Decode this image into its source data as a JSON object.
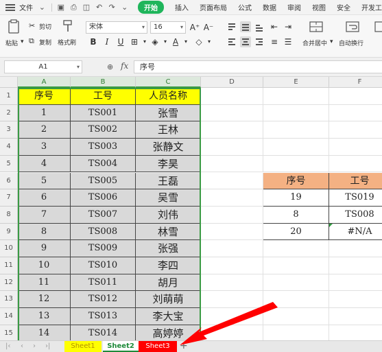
{
  "menubar": {
    "file_label": "文件",
    "tabs": [
      "开始",
      "插入",
      "页面布局",
      "公式",
      "数据",
      "审阅",
      "视图",
      "安全",
      "开发工"
    ]
  },
  "ribbon": {
    "cut_label": "剪切",
    "paste_label": "粘贴",
    "copy_label": "复制",
    "format_painter_label": "格式刷",
    "font_name": "宋体",
    "font_size": "16",
    "merge_label": "合并居中",
    "wrap_label": "自动换行"
  },
  "formula_bar": {
    "cell_ref": "A1",
    "fx": "fx",
    "content": "序号"
  },
  "columns": [
    "A",
    "B",
    "C",
    "D",
    "E",
    "F"
  ],
  "rows": [
    "1",
    "2",
    "3",
    "4",
    "5",
    "6",
    "7",
    "8",
    "9",
    "10",
    "11",
    "12",
    "13",
    "14",
    "15"
  ],
  "table_headers": [
    "序号",
    "工号",
    "人员名称"
  ],
  "table_rows": [
    [
      "1",
      "TS001",
      "张雪"
    ],
    [
      "2",
      "TS002",
      "王林"
    ],
    [
      "3",
      "TS003",
      "张静文"
    ],
    [
      "4",
      "TS004",
      "李昊"
    ],
    [
      "5",
      "TS005",
      "王磊"
    ],
    [
      "6",
      "TS006",
      "吴雪"
    ],
    [
      "7",
      "TS007",
      "刘伟"
    ],
    [
      "8",
      "TS008",
      "林雪"
    ],
    [
      "9",
      "TS009",
      "张强"
    ],
    [
      "10",
      "TS010",
      "李四"
    ],
    [
      "11",
      "TS011",
      "胡月"
    ],
    [
      "12",
      "TS012",
      "刘萌萌"
    ],
    [
      "13",
      "TS013",
      "李大宝"
    ],
    [
      "14",
      "TS014",
      "高婷婷"
    ]
  ],
  "lookup_headers": [
    "序号",
    "工号"
  ],
  "lookup_rows": [
    [
      "19",
      "TS019"
    ],
    [
      "8",
      "TS008"
    ],
    [
      "20",
      "#N/A"
    ]
  ],
  "sheets": [
    "Sheet1",
    "Sheet2",
    "Sheet3"
  ],
  "add_sheet": "+",
  "colors": {
    "accent": "#1fb55b",
    "header_fill": "#ffff00",
    "data_fill": "#d9d9d9",
    "lookup_header_fill": "#f4b183",
    "sheet3_fill": "#ff0000",
    "arrow": "#ff0000"
  }
}
